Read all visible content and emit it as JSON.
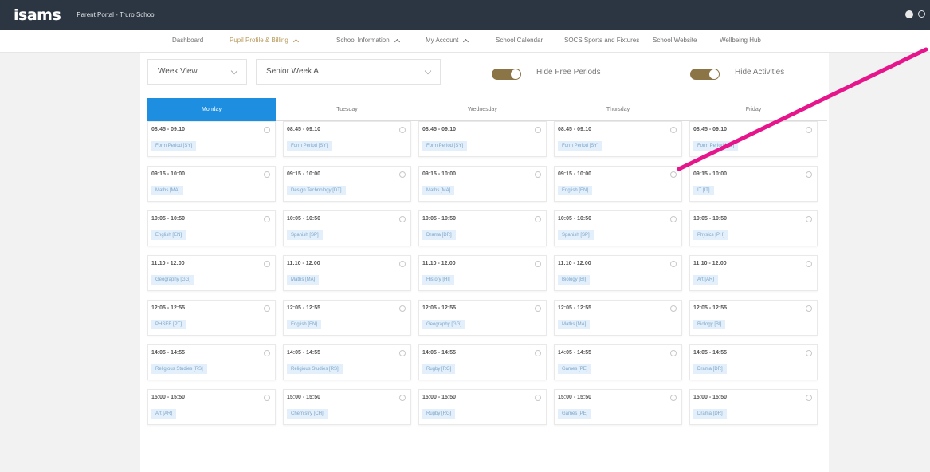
{
  "header": {
    "logo": "isams",
    "portal_title": "Parent Portal - Truro School"
  },
  "nav": {
    "items": [
      {
        "label": "Dashboard"
      },
      {
        "label": "Pupil Profile & Billing",
        "active": true
      },
      {
        "label": "School Information"
      },
      {
        "label": "My Account"
      },
      {
        "label": "School Calendar"
      },
      {
        "label": "SOCS Sports and Fixtures"
      },
      {
        "label": "School Website"
      },
      {
        "label": "Wellbeing Hub"
      }
    ]
  },
  "filters": {
    "view": "Week View",
    "week": "Senior Week A",
    "hide_free_periods": {
      "label": "Hide Free Periods",
      "on": true
    },
    "hide_activities": {
      "label": "Hide Activities",
      "on": true
    }
  },
  "timetable": {
    "days": [
      {
        "name": "Monday",
        "active": true,
        "periods": [
          {
            "time": "08:45 - 09:10",
            "subject": "Form Period [SY]"
          },
          {
            "time": "09:15 - 10:00",
            "subject": "Maths [MA]"
          },
          {
            "time": "10:05 - 10:50",
            "subject": "English [EN]"
          },
          {
            "time": "11:10 - 12:00",
            "subject": "Geography [GG]"
          },
          {
            "time": "12:05 - 12:55",
            "subject": "PHSEE [PT]"
          },
          {
            "time": "14:05 - 14:55",
            "subject": "Religious Studies [RS]"
          },
          {
            "time": "15:00 - 15:50",
            "subject": "Art [AR]"
          }
        ]
      },
      {
        "name": "Tuesday",
        "periods": [
          {
            "time": "08:45 - 09:10",
            "subject": "Form Period [SY]"
          },
          {
            "time": "09:15 - 10:00",
            "subject": "Design Technology [DT]"
          },
          {
            "time": "10:05 - 10:50",
            "subject": "Spanish [SP]"
          },
          {
            "time": "11:10 - 12:00",
            "subject": "Maths [MA]"
          },
          {
            "time": "12:05 - 12:55",
            "subject": "English [EN]"
          },
          {
            "time": "14:05 - 14:55",
            "subject": "Religious Studies [RS]"
          },
          {
            "time": "15:00 - 15:50",
            "subject": "Chemistry [CH]"
          }
        ]
      },
      {
        "name": "Wednesday",
        "periods": [
          {
            "time": "08:45 - 09:10",
            "subject": "Form Period [SY]"
          },
          {
            "time": "09:15 - 10:00",
            "subject": "Maths [MA]"
          },
          {
            "time": "10:05 - 10:50",
            "subject": "Drama [DR]"
          },
          {
            "time": "11:10 - 12:00",
            "subject": "History [HI]"
          },
          {
            "time": "12:05 - 12:55",
            "subject": "Geography [GG]"
          },
          {
            "time": "14:05 - 14:55",
            "subject": "Rugby [RG]"
          },
          {
            "time": "15:00 - 15:50",
            "subject": "Rugby [RG]"
          }
        ]
      },
      {
        "name": "Thursday",
        "periods": [
          {
            "time": "08:45 - 09:10",
            "subject": "Form Period [SY]"
          },
          {
            "time": "09:15 - 10:00",
            "subject": "English [EN]"
          },
          {
            "time": "10:05 - 10:50",
            "subject": "Spanish [SP]"
          },
          {
            "time": "11:10 - 12:00",
            "subject": "Biology [BI]"
          },
          {
            "time": "12:05 - 12:55",
            "subject": "Maths [MA]"
          },
          {
            "time": "14:05 - 14:55",
            "subject": "Games [PE]"
          },
          {
            "time": "15:00 - 15:50",
            "subject": "Games [PE]"
          }
        ]
      },
      {
        "name": "Friday",
        "periods": [
          {
            "time": "08:45 - 09:10",
            "subject": "Form Period [SY]"
          },
          {
            "time": "09:15 - 10:00",
            "subject": "IT [IT]"
          },
          {
            "time": "10:05 - 10:50",
            "subject": "Physics [PH]"
          },
          {
            "time": "11:10 - 12:00",
            "subject": "Art [AR]"
          },
          {
            "time": "12:05 - 12:55",
            "subject": "Biology [BI]"
          },
          {
            "time": "14:05 - 14:55",
            "subject": "Drama [DR]"
          },
          {
            "time": "15:00 - 15:50",
            "subject": "Drama [DR]"
          }
        ]
      }
    ]
  },
  "colors": {
    "topbar": "#2b3642",
    "accent_gold": "#b89a5a",
    "active_day": "#1e8fe0",
    "toggle_on": "#8b7446",
    "subject_chip": "#e3f0fb",
    "annotation_arrow": "#e6158c"
  }
}
